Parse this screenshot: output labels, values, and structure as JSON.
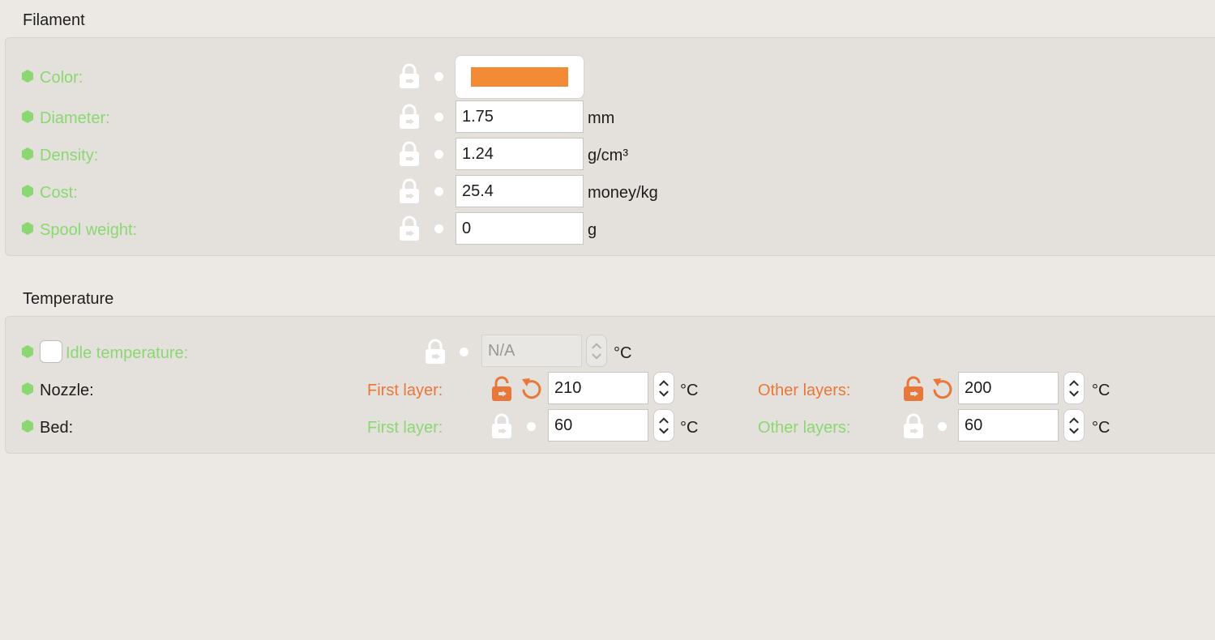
{
  "filament": {
    "title": "Filament",
    "color_label": "Color:",
    "color_value": "#F28A36",
    "diameter": {
      "label": "Diameter:",
      "value": "1.75",
      "unit": "mm"
    },
    "density": {
      "label": "Density:",
      "value": "1.24",
      "unit": "g/cm³"
    },
    "cost": {
      "label": "Cost:",
      "value": "25.4",
      "unit": "money/kg"
    },
    "spool_weight": {
      "label": "Spool weight:",
      "value": "0",
      "unit": "g"
    }
  },
  "temperature": {
    "title": "Temperature",
    "idle": {
      "label": "Idle temperature:",
      "value": "N/A",
      "unit": "°C"
    },
    "nozzle": {
      "label": "Nozzle:",
      "first_label": "First layer:",
      "first_value": "210",
      "first_unit": "°C",
      "other_label": "Other layers:",
      "other_value": "200",
      "other_unit": "°C"
    },
    "bed": {
      "label": "Bed:",
      "first_label": "First layer:",
      "first_value": "60",
      "first_unit": "°C",
      "other_label": "Other layers:",
      "other_value": "60",
      "other_unit": "°C"
    }
  },
  "colors": {
    "system_green": "#8BD772",
    "modified_orange": "#E8773A",
    "filament_color": "#F28A36"
  },
  "icons": {
    "hex": "hexagon-icon",
    "lock": "lock-icon",
    "unlock": "unlock-icon",
    "undo": "undo-arrow-icon",
    "dot": "bullet-icon",
    "spinner": "chevron-up-down-icon"
  }
}
